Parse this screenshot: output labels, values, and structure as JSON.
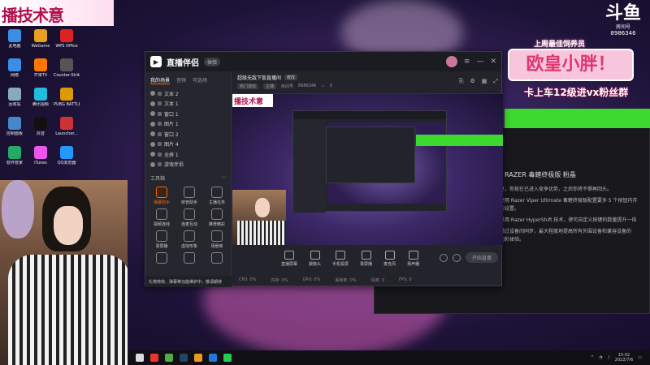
{
  "overlay": {
    "top_banner_text": "播技术意",
    "room_logo_main": "斗鱼",
    "room_logo_sub": "房间号",
    "room_number": "8986346",
    "promo_line1": "上周最佳饲养员",
    "promo_main": "欧皇小胖！",
    "promo_line3": "卡上车12级进vx粉丝群"
  },
  "desktop": {
    "icons": [
      {
        "label": "此电脑",
        "color": "#3a8ee6"
      },
      {
        "label": "WeGame",
        "color": "#e8a020"
      },
      {
        "label": "WPS Office",
        "color": "#d22"
      },
      {
        "label": "网络",
        "color": "#3a8ee6"
      },
      {
        "label": "芒果TV",
        "color": "#f70"
      },
      {
        "label": "Counter-Strike Global Off...",
        "color": "#555"
      },
      {
        "label": "回收站",
        "color": "#8ab"
      },
      {
        "label": "腾讯视频",
        "color": "#2bd"
      },
      {
        "label": "PUBG BATTLEGR...",
        "color": "#d90"
      },
      {
        "label": "控制面板",
        "color": "#48c"
      },
      {
        "label": "抖音",
        "color": "#111"
      },
      {
        "label": "Launcher...",
        "color": "#c33"
      },
      {
        "label": "软件管家",
        "color": "#2a6"
      },
      {
        "label": "iTunes",
        "color": "#e5e"
      },
      {
        "label": "QQ浏览器",
        "color": "#29f"
      }
    ]
  },
  "app": {
    "name": "直播伴侣",
    "version": "体验",
    "sidebar": {
      "tabs": [
        "我的场景",
        "音频",
        "可选场"
      ],
      "scenes": [
        "文本 2",
        "文本 1",
        "窗口 1",
        "图片 1",
        "窗口 2",
        "图片 4",
        "全屏 1",
        "游戏伴侣"
      ],
      "toolbox_label": "工具箱",
      "tools": [
        {
          "label": "弹幕助手",
          "active": true
        },
        {
          "label": "房管助手",
          "active": false
        },
        {
          "label": "主播任务",
          "active": false
        },
        {
          "label": "视频连线",
          "active": false
        },
        {
          "label": "连麦互动",
          "active": false
        },
        {
          "label": "推荐精彩",
          "active": false
        },
        {
          "label": "录屏播",
          "active": false
        },
        {
          "label": "虚拟形象",
          "active": false
        },
        {
          "label": "场景库",
          "active": false
        },
        {
          "label": "",
          "active": false
        },
        {
          "label": "",
          "active": false
        },
        {
          "label": "",
          "active": false
        }
      ],
      "footer": "礼物特效、弹幕等功能维护中，敬请期待"
    },
    "room": {
      "title": "超级无敌下饭直播间",
      "edit_tag": "修改",
      "category": "热门游戏",
      "subcategory": "主播",
      "room_id_label": "房间号",
      "room_id": "8986346",
      "hot": "0"
    },
    "controls": [
      "直播屏幕",
      "摄像头",
      "手机投屏",
      "录屏播",
      "麦克风",
      "扬声器"
    ],
    "live_button": "开始直播",
    "status": [
      "CPU: 0%",
      "内存: 0%",
      "GPU: 0%",
      "丢帧率: 0%",
      "码率: 0",
      "FPS: 0"
    ]
  },
  "right_window": {
    "heading": "RAZER 毒蝰终极版 粉晶",
    "lines": [
      "享，你现在已进入竞争优势，之后你将不惧再回头。",
      "使用 Razer Viper Ultimate 毒蝰终极版配置要多 5 个按钮内存",
      "的设置。",
      "采用 Razer HyperShift 技术，使可自定义按键的数量提升一倍",
      "通过设备间同步，最大程度地提高所有外围设备和兼容设备的",
      "幻彩体验。"
    ]
  },
  "taskbar": {
    "time": "15:02",
    "date": "2022/7/6",
    "icons": [
      {
        "name": "circle",
        "color": "#ddd"
      },
      {
        "name": "weibo",
        "color": "#e33"
      },
      {
        "name": "chrome",
        "color": "#5a4"
      },
      {
        "name": "steam",
        "color": "#246"
      },
      {
        "name": "app-orange",
        "color": "#e92"
      },
      {
        "name": "app-blue",
        "color": "#27d"
      },
      {
        "name": "spotify",
        "color": "#2c5"
      }
    ]
  }
}
